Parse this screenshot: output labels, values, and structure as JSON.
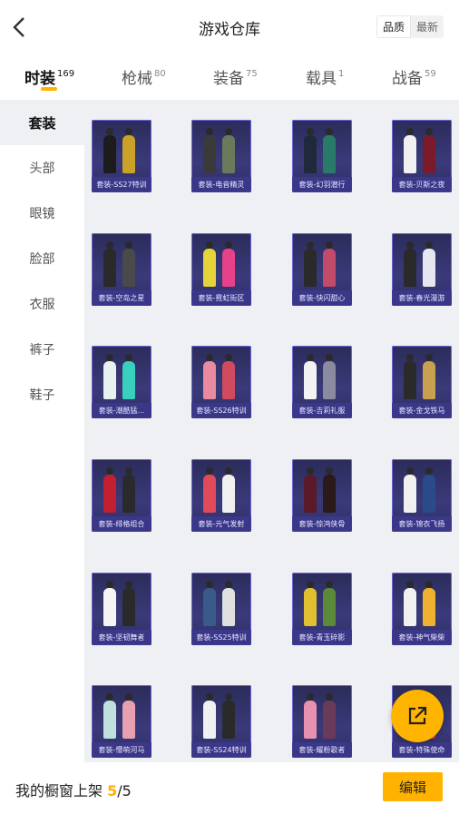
{
  "header": {
    "title": "游戏仓库"
  },
  "sort": {
    "quality": "品质",
    "newest": "最新"
  },
  "tabs": [
    {
      "label": "时装",
      "count": "169"
    },
    {
      "label": "枪械",
      "count": "80"
    },
    {
      "label": "装备",
      "count": "75"
    },
    {
      "label": "载具",
      "count": "1"
    },
    {
      "label": "战备",
      "count": "59"
    }
  ],
  "sidebar": {
    "items": [
      "套装",
      "头部",
      "眼镜",
      "脸部",
      "衣服",
      "裤子",
      "鞋子"
    ]
  },
  "items": [
    "套装-SS27特训",
    "套装-电音精灵",
    "套装-幻羽潜行",
    "套装-贝斯之夜",
    "套装-空岛之星",
    "套装-霓虹街区",
    "套装-快闪甜心",
    "套装-春光漫游",
    "套装-潮酷猛...",
    "套装-SS26特训",
    "套装-吉莉礼服",
    "套装-金戈铁马",
    "套装-绯格组合",
    "套装-元气发射",
    "套装-惊鸿侠骨",
    "套装-锦衣飞扬",
    "套装-坚韧舞者",
    "套装-SS25特训",
    "套装-青玉碎影",
    "套装-神气柴柴",
    "套装-懵萌河马",
    "套装-SS24特训",
    "套装-耀粉歌者",
    "套装-特殊使命"
  ],
  "bottom": {
    "label": "我的橱窗上架 ",
    "count": "5",
    "total": "/5",
    "edit": "编辑"
  },
  "colors": {
    "accent": "#ffb300",
    "card_bg": "#2c2d63",
    "card_border": "#6b63d8"
  },
  "icons": {
    "back": "chevron-left-icon",
    "share": "external-link-icon"
  }
}
